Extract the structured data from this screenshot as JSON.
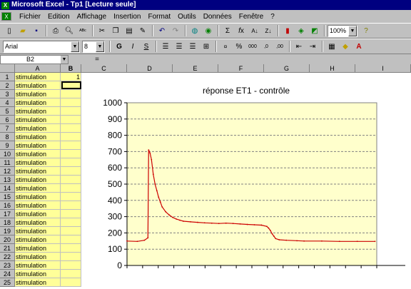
{
  "titlebar": {
    "icon": "excel-icon",
    "title": "Microsoft Excel - Tp1  [Lecture seule]"
  },
  "menu": {
    "items": [
      "Fichier",
      "Edition",
      "Affichage",
      "Insertion",
      "Format",
      "Outils",
      "Données",
      "Fenêtre",
      "?"
    ]
  },
  "toolbar": {
    "zoom": "100%"
  },
  "format_bar": {
    "font": "Arial",
    "size": "8"
  },
  "formula_bar": {
    "name_box": "B2",
    "fx": "="
  },
  "sheet": {
    "columns": [
      "A",
      "B",
      "C",
      "D",
      "E",
      "F",
      "G",
      "H",
      "I"
    ],
    "selected_column": "B",
    "rows": [
      "1",
      "2",
      "3",
      "4",
      "5",
      "6",
      "7",
      "8",
      "9",
      "10",
      "11",
      "12",
      "13",
      "14",
      "15",
      "16",
      "17",
      "18",
      "19",
      "20",
      "21",
      "22",
      "23",
      "24",
      "25"
    ],
    "col_a": "stimulation",
    "b1": "1",
    "selected_cell": "B2"
  },
  "colors": {
    "yellow_cells": "#ffff99",
    "plot_area": "#ffffcc",
    "series": "#cc0000",
    "title_bar": "#000080"
  },
  "chart_data": {
    "type": "line",
    "title": "réponse ET1 - contrôle",
    "ylim": [
      0,
      1000
    ],
    "yticks": [
      0,
      100,
      200,
      300,
      400,
      500,
      600,
      700,
      800,
      900,
      1000
    ],
    "xlim": [
      1,
      705
    ],
    "x": [
      1,
      30,
      50,
      60,
      62,
      66,
      70,
      75,
      80,
      85,
      90,
      95,
      100,
      110,
      120,
      130,
      140,
      150,
      160,
      180,
      200,
      220,
      240,
      260,
      280,
      300,
      320,
      340,
      360,
      380,
      395,
      400,
      405,
      410,
      415,
      420,
      430,
      450,
      480,
      500,
      550,
      600,
      650,
      700
    ],
    "y": [
      150,
      148,
      155,
      170,
      710,
      690,
      650,
      560,
      500,
      460,
      420,
      390,
      360,
      330,
      310,
      295,
      285,
      278,
      272,
      268,
      265,
      262,
      260,
      258,
      260,
      258,
      255,
      252,
      250,
      248,
      240,
      230,
      215,
      195,
      180,
      165,
      158,
      155,
      152,
      150,
      150,
      148,
      148,
      148
    ],
    "grid": true
  }
}
